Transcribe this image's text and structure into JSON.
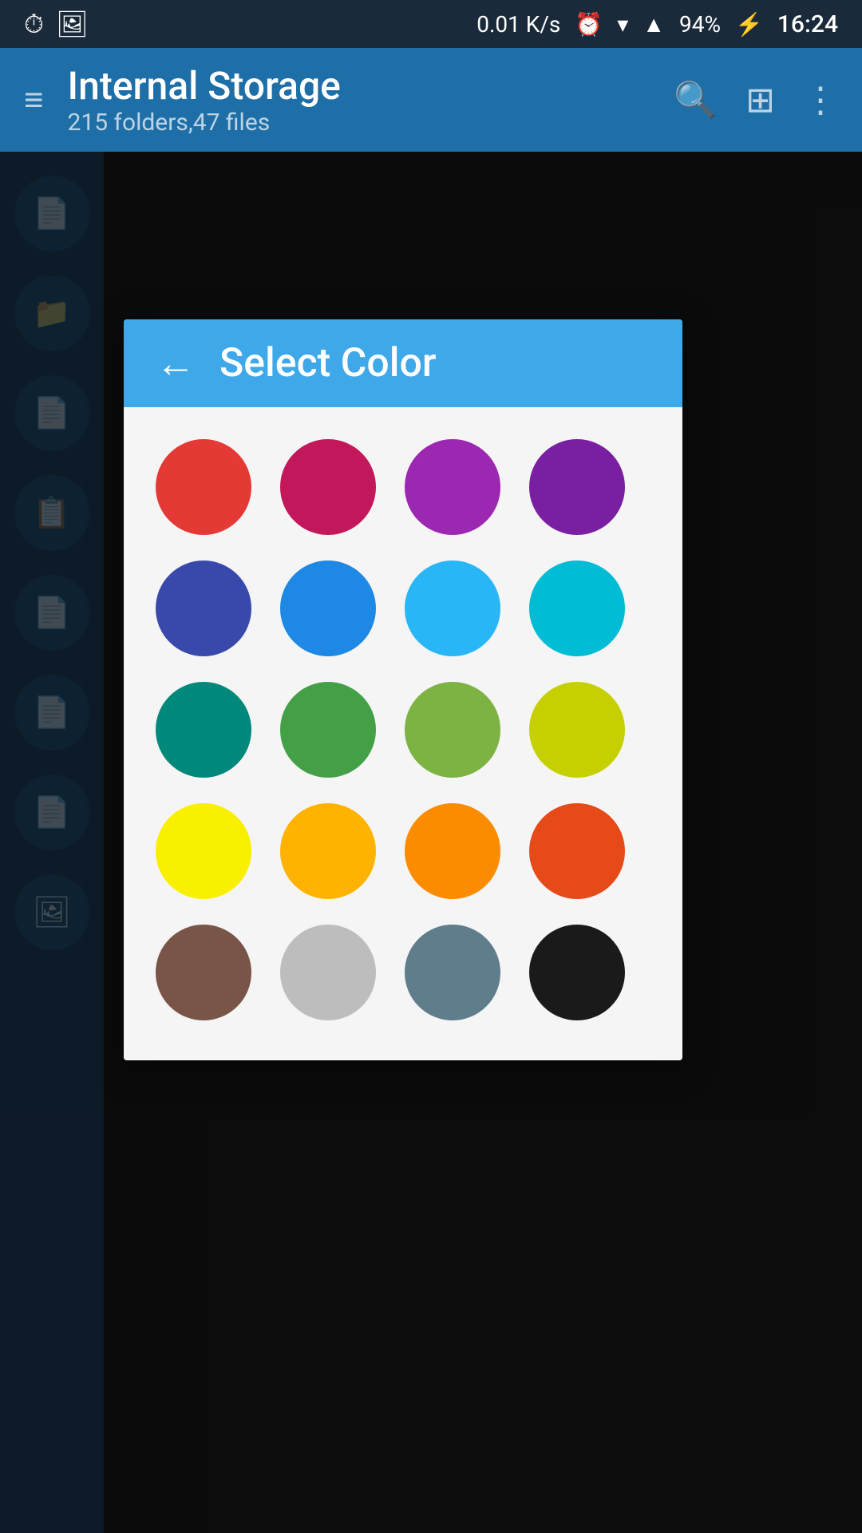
{
  "statusBar": {
    "network": "0.01 K/s",
    "battery": "94%",
    "time": "16:24"
  },
  "header": {
    "title": "Internal Storage",
    "subtitle": "215 folders,47 files",
    "menuIcon": "≡",
    "searchIcon": "🔍",
    "gridIcon": "⊞",
    "moreIcon": "⋮"
  },
  "dialog": {
    "backLabel": "←",
    "title": "Select Color",
    "colors": [
      {
        "name": "red",
        "hex": "#e53935"
      },
      {
        "name": "crimson",
        "hex": "#c2185b"
      },
      {
        "name": "purple-medium",
        "hex": "#9c27b0"
      },
      {
        "name": "purple-dark",
        "hex": "#7b1fa2"
      },
      {
        "name": "indigo",
        "hex": "#3949ab"
      },
      {
        "name": "blue",
        "hex": "#1e88e5"
      },
      {
        "name": "light-blue",
        "hex": "#29b6f6"
      },
      {
        "name": "cyan",
        "hex": "#00bcd4"
      },
      {
        "name": "teal",
        "hex": "#00897b"
      },
      {
        "name": "green",
        "hex": "#43a047"
      },
      {
        "name": "light-green",
        "hex": "#7cb342"
      },
      {
        "name": "lime",
        "hex": "#c6d000"
      },
      {
        "name": "yellow",
        "hex": "#f9f000"
      },
      {
        "name": "amber",
        "hex": "#ffb300"
      },
      {
        "name": "orange",
        "hex": "#fb8c00"
      },
      {
        "name": "deep-orange",
        "hex": "#e64a19"
      },
      {
        "name": "brown",
        "hex": "#795548"
      },
      {
        "name": "grey",
        "hex": "#bdbdbd"
      },
      {
        "name": "blue-grey",
        "hex": "#607d8b"
      },
      {
        "name": "black",
        "hex": "#1a1a1a"
      }
    ]
  }
}
